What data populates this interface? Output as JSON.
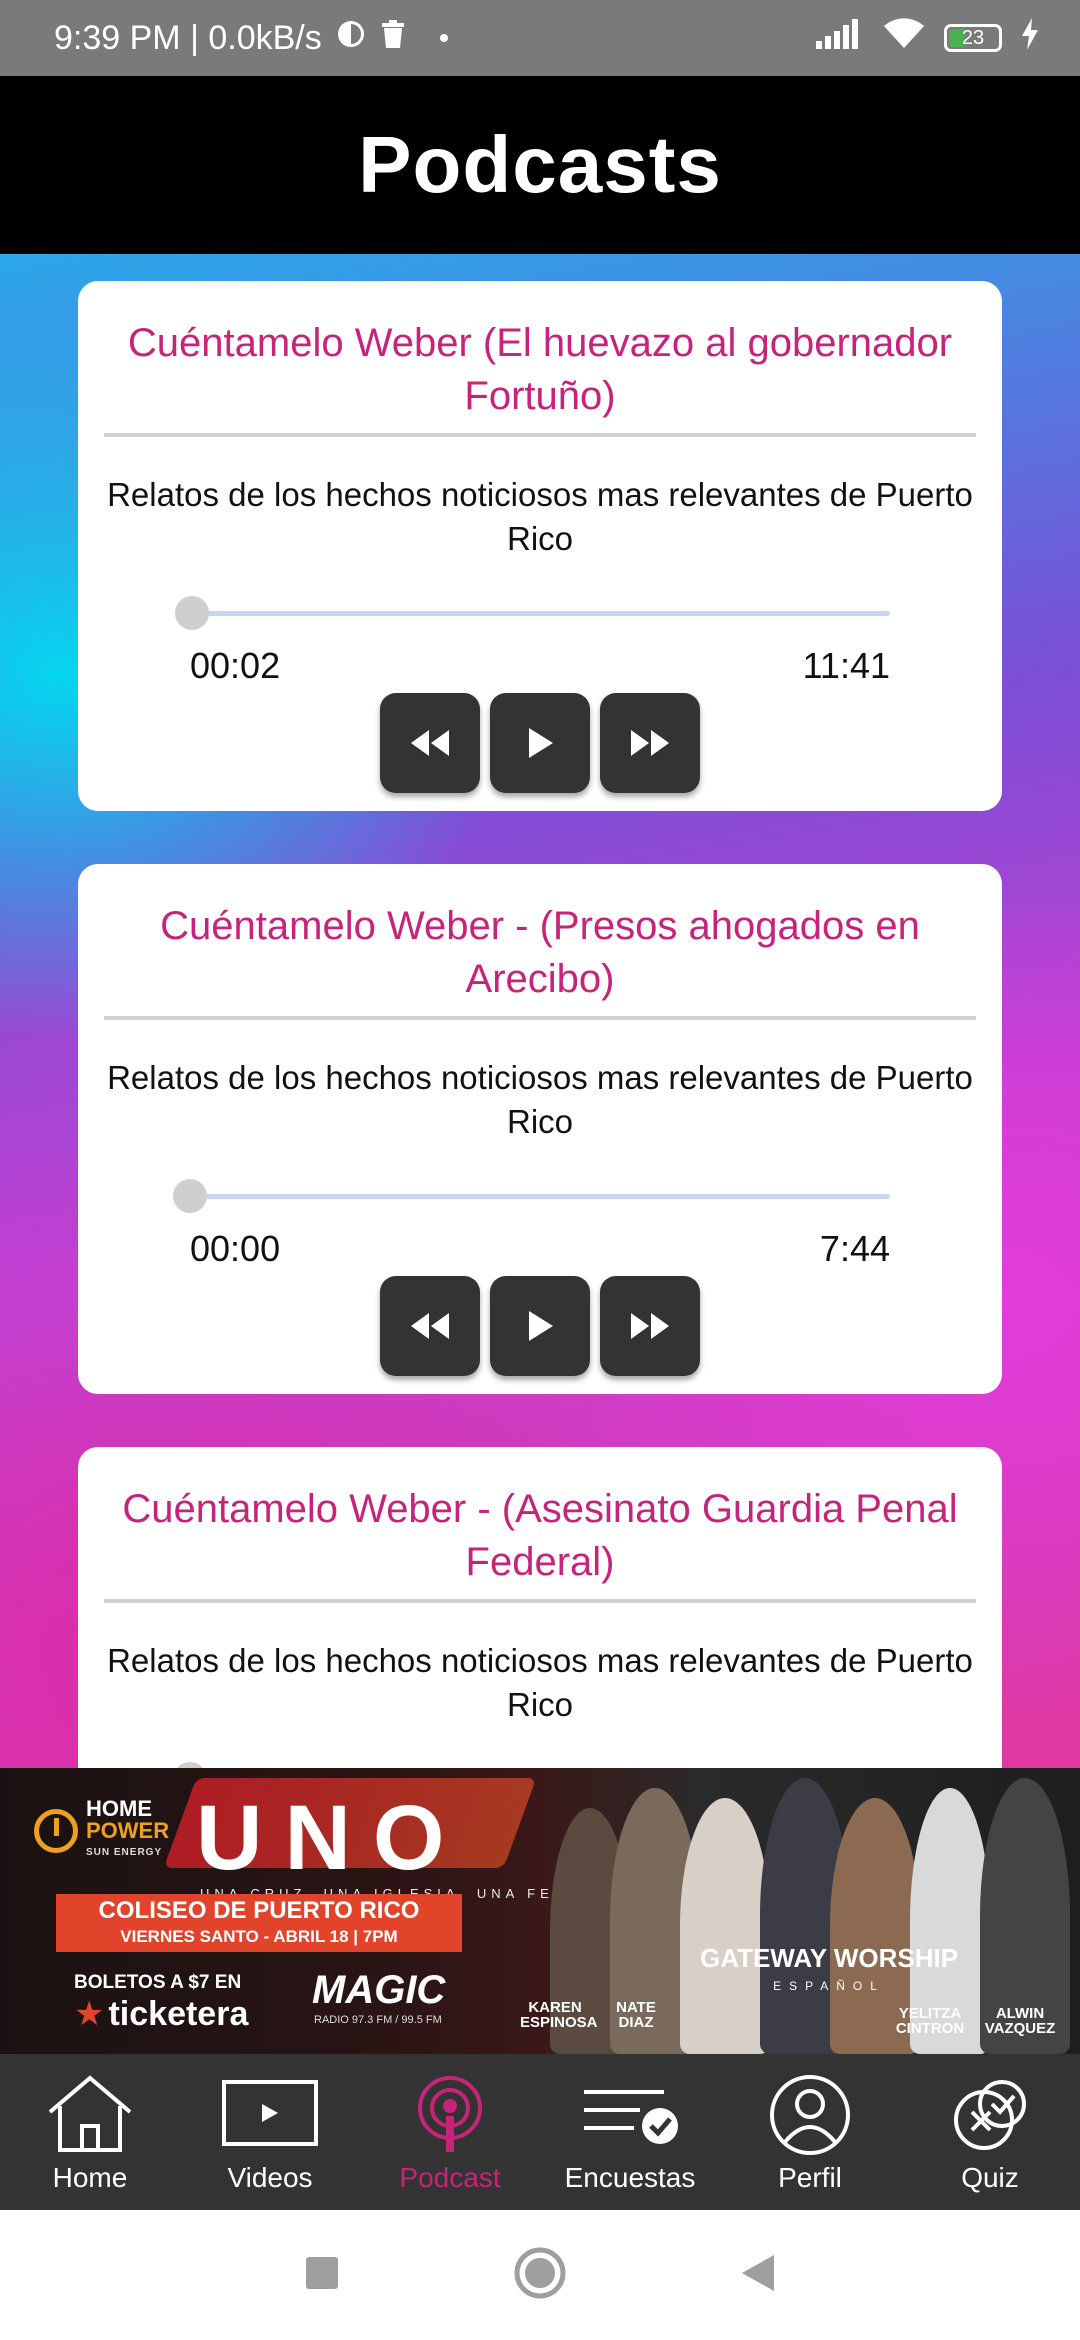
{
  "status_bar": {
    "time_speed": "9:39 PM | 0.0kB/s",
    "battery": "23",
    "battery_color": "#4caf50"
  },
  "header": {
    "title": "Podcasts"
  },
  "podcasts": [
    {
      "title": "Cuéntamelo Weber (El huevazo al gobernador Fortuño)",
      "description": "Relatos de los hechos noticiosos mas relevantes de Puerto Rico",
      "current_time": "00:02",
      "duration": "11:41",
      "progress": 0.003
    },
    {
      "title": "Cuéntamelo Weber - (Presos ahogados en Arecibo)",
      "description": "Relatos de los hechos noticiosos mas relevantes de Puerto Rico",
      "current_time": "00:00",
      "duration": "7:44",
      "progress": 0.0
    },
    {
      "title": "Cuéntamelo Weber - (Asesinato Guardia Penal Federal)",
      "description": "Relatos de los hechos noticiosos mas relevantes de Puerto Rico"
    }
  ],
  "banner": {
    "sponsor_line1": "HOME",
    "sponsor_line2": "POWER",
    "sponsor_line3": "SUN ENERGY",
    "headline": "UNO",
    "tagline": "UNA CRUZ. UNA IGLESIA. UNA FE",
    "venue": "COLISEO DE PUERTO RICO",
    "date": "VIERNES SANTO - ABRIL 18 | 7PM",
    "tickets": "BOLETOS A $7 EN",
    "ticketer": "ticketera",
    "radio": "MAGIC",
    "radio_sub": "RADIO 97.3 FM / 99.5 FM",
    "band": "GATEWAY WORSHIP",
    "band_sub": "ESPAÑOL",
    "artists": [
      "KAREN ESPINOSA",
      "NATE DIAZ",
      "YELITZA CINTRON",
      "ALWIN VAZQUEZ"
    ]
  },
  "bottom_nav": {
    "items": [
      {
        "label": "Home",
        "icon": "home-icon"
      },
      {
        "label": "Videos",
        "icon": "video-icon"
      },
      {
        "label": "Podcast",
        "icon": "podcast-icon"
      },
      {
        "label": "Encuestas",
        "icon": "survey-icon"
      },
      {
        "label": "Perfil",
        "icon": "profile-icon"
      },
      {
        "label": "Quiz",
        "icon": "quiz-icon"
      }
    ],
    "active": "Podcast",
    "active_color": "#c8237a"
  },
  "colors": {
    "title_accent": "#c8237a",
    "header_bg": "#000000",
    "control_bg": "#333333"
  }
}
